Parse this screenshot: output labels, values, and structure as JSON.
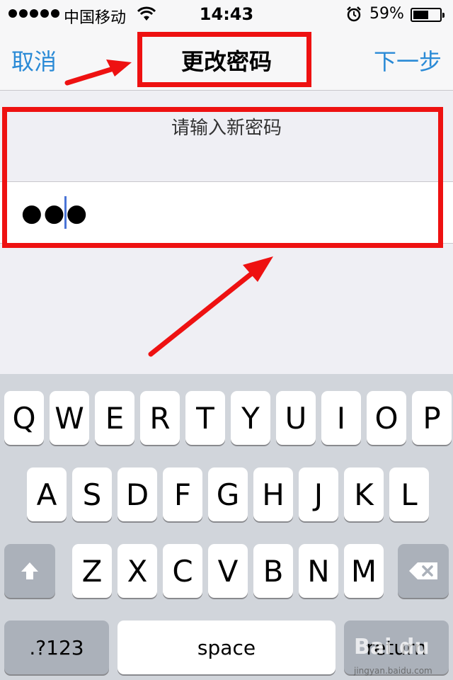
{
  "status_bar": {
    "carrier": "中国移动",
    "time": "14:43",
    "battery_percent": "59%",
    "battery_level": 0.59,
    "signal_dots": 5,
    "icons": [
      "signal-dots-icon",
      "wifi-icon",
      "alarm-clock-icon",
      "battery-icon"
    ]
  },
  "nav": {
    "cancel_label": "取消",
    "title": "更改密码",
    "next_label": "下一步"
  },
  "form": {
    "prompt": "请输入新密码",
    "password_value": "●●●"
  },
  "keyboard": {
    "rows": [
      [
        "Q",
        "W",
        "E",
        "R",
        "T",
        "Y",
        "U",
        "I",
        "O",
        "P"
      ],
      [
        "A",
        "S",
        "D",
        "F",
        "G",
        "H",
        "J",
        "K",
        "L"
      ],
      [
        "Z",
        "X",
        "C",
        "V",
        "B",
        "N",
        "M"
      ]
    ],
    "shift_icon": "shift-arrow-icon",
    "delete_icon": "backspace-icon",
    "numbers_label": ".?123",
    "space_label": "space",
    "return_label": "return"
  },
  "watermark": {
    "logo_text": "Bai du",
    "url": "jingyan.baidu.com"
  },
  "colors": {
    "nav_link": "#2a8ad6",
    "annotation_red": "#ee1111",
    "caret": "#4a74d6",
    "keyboard_bg": "#d1d5db"
  }
}
